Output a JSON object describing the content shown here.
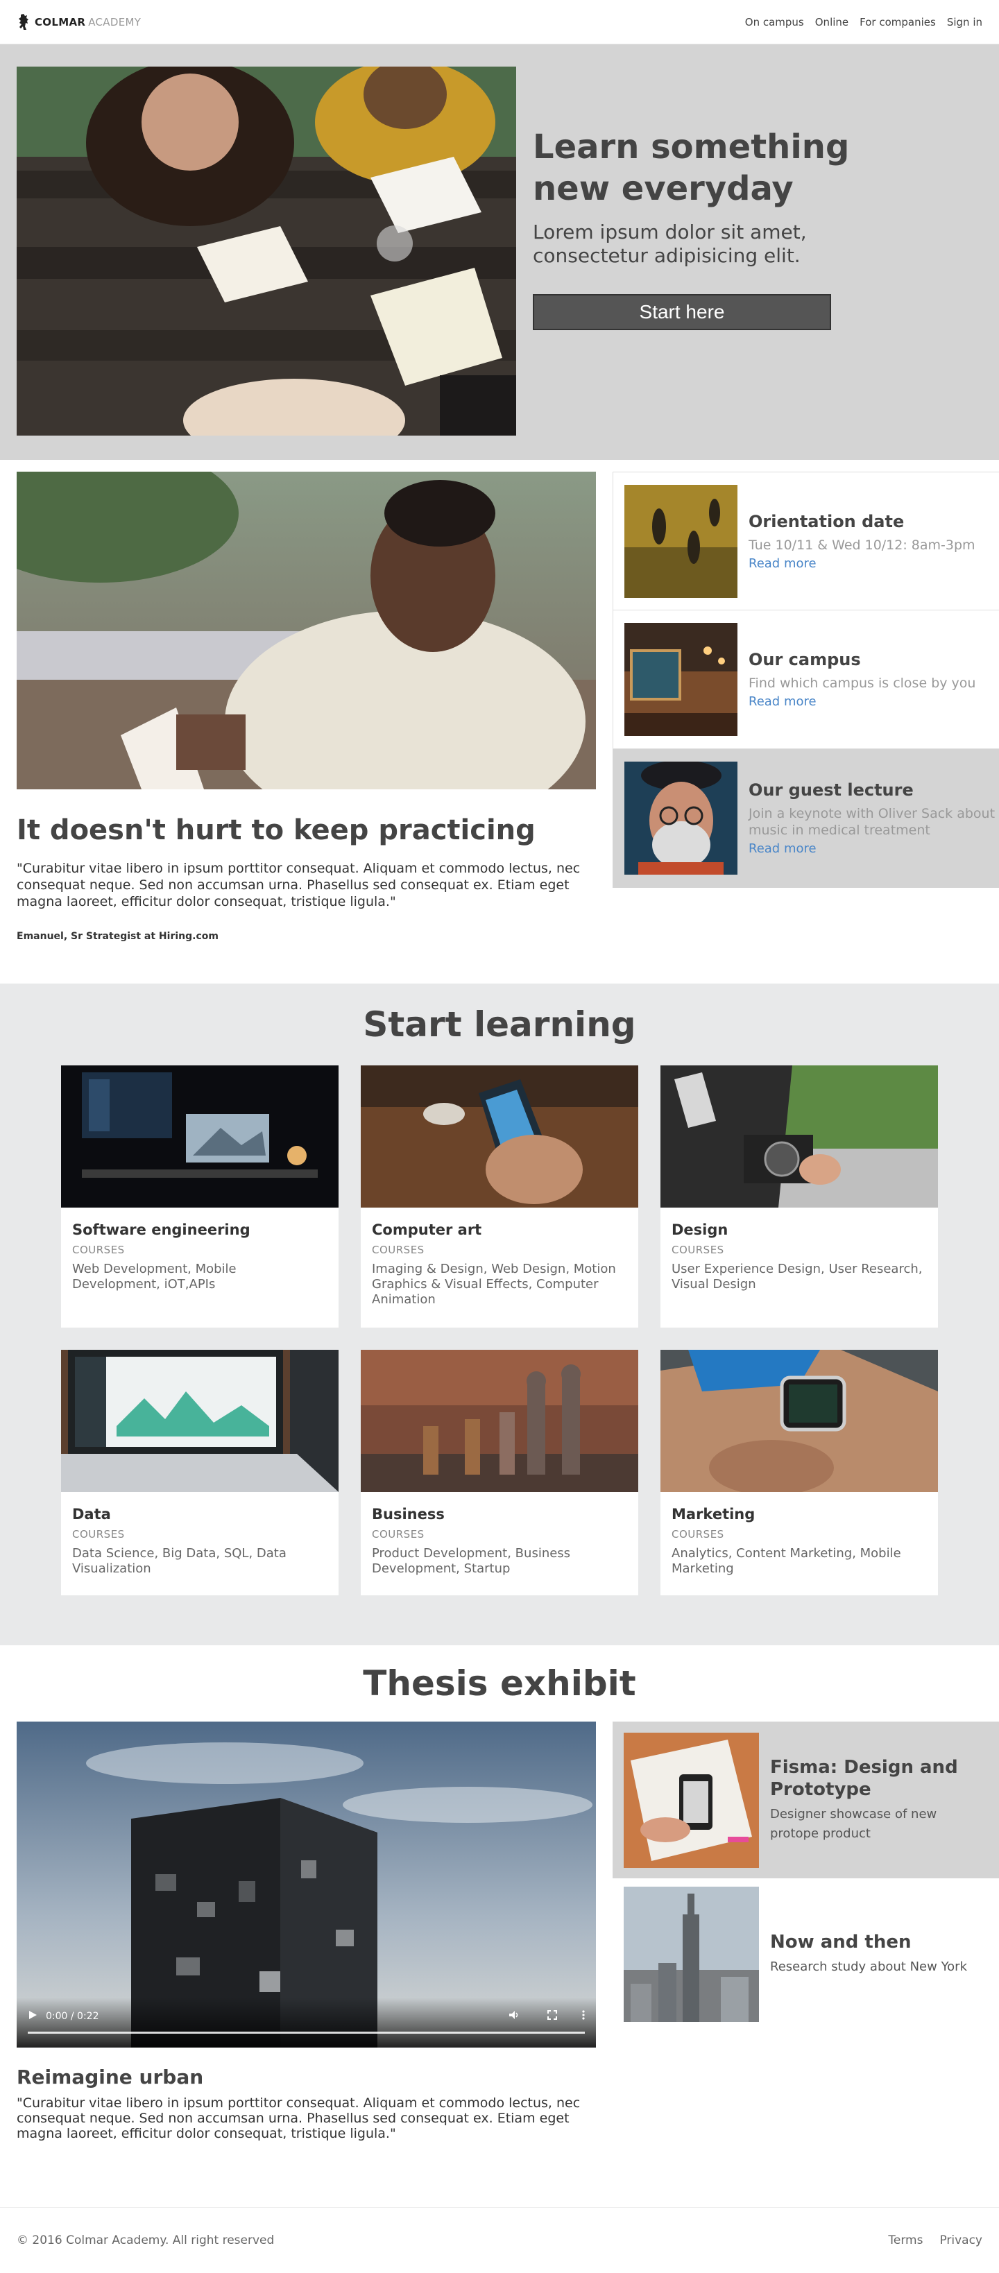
{
  "header": {
    "logo_strong": "COLMAR",
    "logo_light": "ACADEMY",
    "nav": [
      "On campus",
      "Online",
      "For companies",
      "Sign in"
    ]
  },
  "hero": {
    "title": "Learn something new everyday",
    "subtitle": "Lorem ipsum dolor sit amet, consectetur adipisicing elit.",
    "cta": "Start here"
  },
  "practice": {
    "title": "It doesn't hurt to keep practicing",
    "quote": "\"Curabitur vitae libero in ipsum porttitor consequat. Aliquam et commodo lectus, nec consequat neque. Sed non accumsan urna. Phasellus sed consequat ex. Etiam eget magna laoreet, efficitur dolor consequat, tristique ligula.\"",
    "author": "Emanuel, Sr Strategist at Hiring.com"
  },
  "events": [
    {
      "title": "Orientation date",
      "desc": "Tue 10/11 & Wed 10/12: 8am-3pm",
      "link": "Read more"
    },
    {
      "title": "Our campus",
      "desc": "Find which campus is close by you",
      "link": "Read more"
    },
    {
      "title": "Our guest lecture",
      "desc": "Join a keynote with Oliver Sack about music in medical treatment",
      "link": "Read more"
    }
  ],
  "learning": {
    "title": "Start learning",
    "courses": [
      {
        "name": "Software engineering",
        "tag": "COURSES",
        "list": "Web Development, Mobile Development, iOT,APIs"
      },
      {
        "name": "Computer art",
        "tag": "COURSES",
        "list": "Imaging & Design, Web Design, Motion Graphics & Visual Effects, Computer Animation"
      },
      {
        "name": "Design",
        "tag": "COURSES",
        "list": "User Experience Design, User Research, Visual Design"
      },
      {
        "name": "Data",
        "tag": "COURSES",
        "list": "Data Science, Big Data, SQL, Data Visualization"
      },
      {
        "name": "Business",
        "tag": "COURSES",
        "list": "Product Development, Business Development, Startup"
      },
      {
        "name": "Marketing",
        "tag": "COURSES",
        "list": "Analytics, Content Marketing, Mobile Marketing"
      }
    ]
  },
  "thesis": {
    "title": "Thesis exhibit",
    "video_time": "0:00 / 0:22",
    "caption_title": "Reimagine urban",
    "caption_quote": "\"Curabitur vitae libero in ipsum porttitor consequat. Aliquam et commodo lectus, nec consequat neque. Sed non accumsan urna. Phasellus sed consequat ex. Etiam eget magna laoreet, efficitur dolor consequat, tristique ligula.\"",
    "cards": [
      {
        "title": "Fisma: Design and Prototype",
        "desc": "Designer showcase of new protope product"
      },
      {
        "title": "Now and then",
        "desc": "Research study about New York"
      }
    ]
  },
  "footer": {
    "copyright": "© 2016 Colmar Academy. All right reserved",
    "links": [
      "Terms",
      "Privacy"
    ]
  },
  "colors": {
    "hero_bg": "#d4d4d4",
    "section_bg": "#e8e9ea",
    "link": "#4a86c8",
    "button": "#555555"
  }
}
